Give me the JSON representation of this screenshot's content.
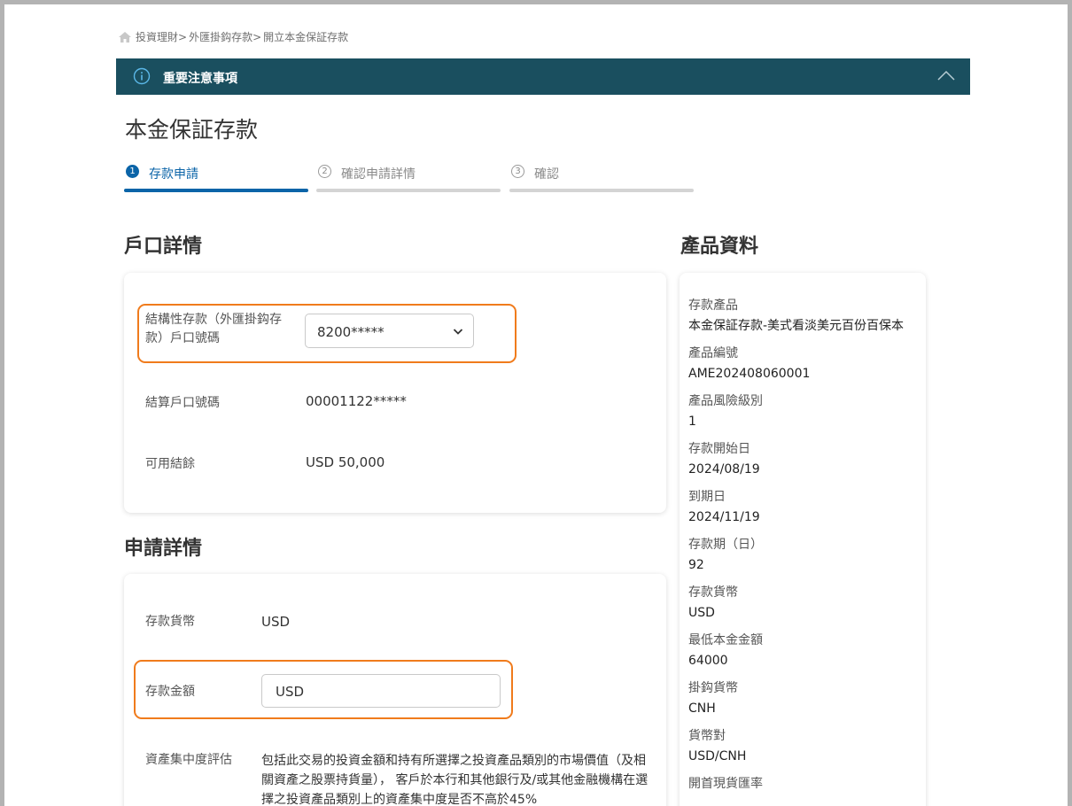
{
  "breadcrumb": {
    "items": [
      "投資理財>",
      "外匯掛鈎存款>",
      "開立本金保証存款"
    ]
  },
  "notice": {
    "title": "重要注意事項",
    "icon": "info-icon",
    "toggle_icon": "chevron-up-icon"
  },
  "page_title": "本金保証存款",
  "steps": [
    {
      "num": "1",
      "label": "存款申請",
      "state": "active"
    },
    {
      "num": "2",
      "label": "確認申請詳情",
      "state": "inactive"
    },
    {
      "num": "3",
      "label": "確認",
      "state": "inactive"
    }
  ],
  "account_section": {
    "title": "戶口詳情",
    "linked_account_label": "結構性存款（外匯掛鈎存款）戶口號碼",
    "linked_account_value": "8200*****",
    "settlement_label": "結算戶口號碼",
    "settlement_value": "00001122*****",
    "balance_label": "可用結餘",
    "balance_value": "USD 50,000"
  },
  "application_section": {
    "title": "申請詳情",
    "currency_label": "存款貨幣",
    "currency_value": "USD",
    "amount_label": "存款金額",
    "amount_value": "USD",
    "concentration_label": "資產集中度評估",
    "concentration_text": "包括此交易的投資金額和持有所選擇之投資產品類別的市場價值（及相關資產之股票持貨量）， 客戶於本行和其他銀行及/或其他金融機構在選擇之投資產品類別上的資產集中度是否不高於45%"
  },
  "product_section": {
    "title": "產品資料",
    "items": [
      {
        "key": "存款產品",
        "value": "本金保証存款-美式看淡美元百份百保本"
      },
      {
        "key": "產品編號",
        "value": "AME202408060001"
      },
      {
        "key": "產品風險級別",
        "value": "1"
      },
      {
        "key": "存款開始日",
        "value": "2024/08/19"
      },
      {
        "key": "到期日",
        "value": "2024/11/19"
      },
      {
        "key": "存款期（日）",
        "value": "92"
      },
      {
        "key": "存款貨幣",
        "value": "USD"
      },
      {
        "key": "最低本金金額",
        "value": "64000"
      },
      {
        "key": "掛鈎貨幣",
        "value": "CNH"
      },
      {
        "key": "貨幣對",
        "value": "USD/CNH"
      },
      {
        "key": "開首現貨匯率",
        "value": ""
      }
    ]
  },
  "colors": {
    "notice_bg": "#1a4f5f",
    "accent": "#0b64a8",
    "highlight": "#f07b1c"
  }
}
